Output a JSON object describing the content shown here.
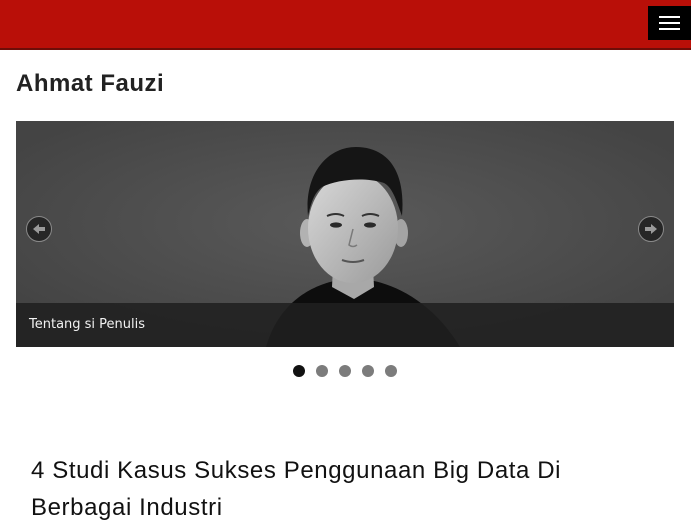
{
  "header": {
    "bg_color": "#b90f08",
    "menu_icon": "hamburger-icon"
  },
  "site": {
    "title": "Ahmat Fauzi"
  },
  "slider": {
    "caption": "Tentang si Penulis",
    "slide_count": 5,
    "active_slide": 1,
    "prev_icon": "arrow-left-icon",
    "next_icon": "arrow-right-icon"
  },
  "post": {
    "title": "4 Studi Kasus Sukses Penggunaan Big Data Di Berbagai Industri"
  }
}
